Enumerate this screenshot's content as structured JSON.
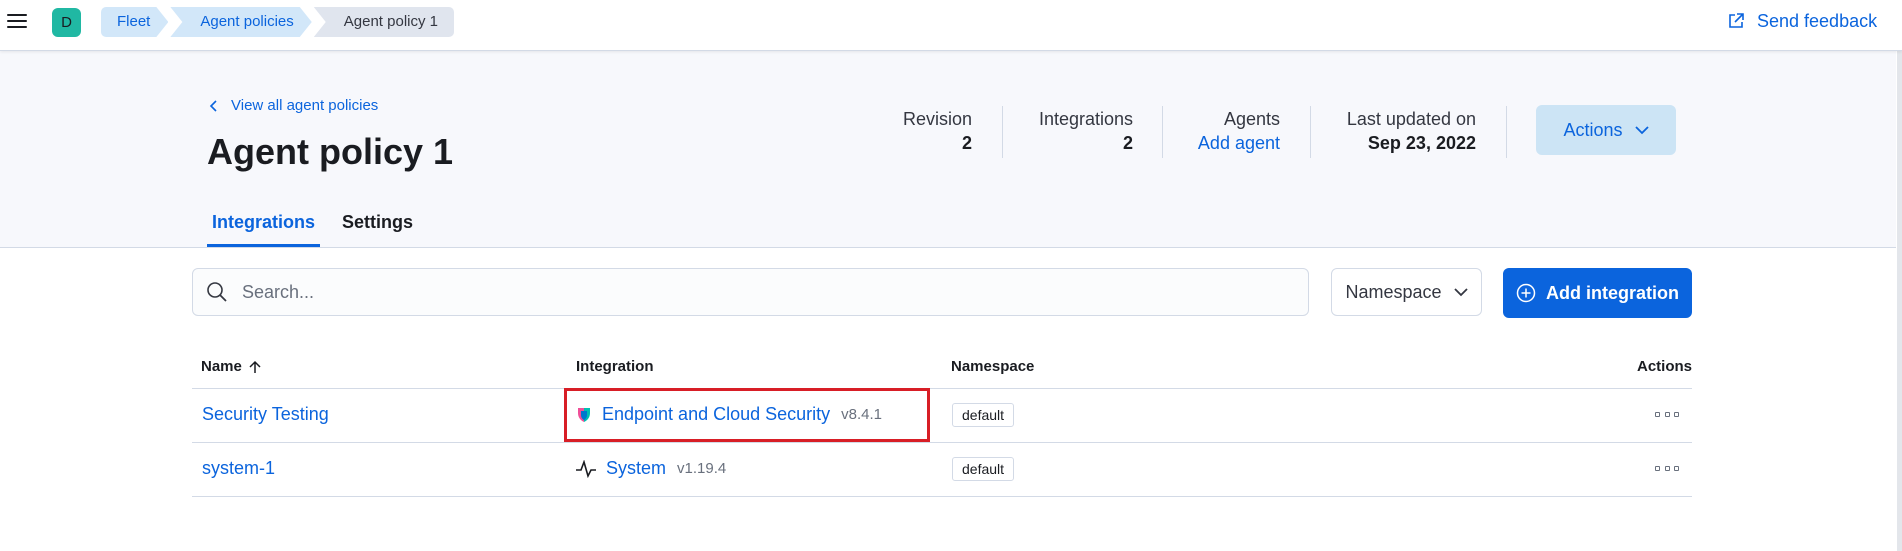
{
  "topbar": {
    "avatar_initial": "D",
    "breadcrumbs": [
      "Fleet",
      "Agent policies",
      "Agent policy 1"
    ],
    "feedback_label": "Send feedback"
  },
  "header": {
    "back_link": "View all agent policies",
    "title": "Agent policy 1",
    "stats": {
      "revision_label": "Revision",
      "revision_value": "2",
      "integrations_label": "Integrations",
      "integrations_value": "2",
      "agents_label": "Agents",
      "agents_value": "Add agent",
      "updated_label": "Last updated on",
      "updated_value": "Sep 23, 2022"
    },
    "actions_label": "Actions",
    "tabs": [
      "Integrations",
      "Settings"
    ]
  },
  "toolbar": {
    "search_placeholder": "Search...",
    "namespace_label": "Namespace",
    "add_integration_label": "Add integration"
  },
  "table": {
    "columns": [
      "Name",
      "Integration",
      "Namespace",
      "Actions"
    ],
    "rows": [
      {
        "name": "Security Testing",
        "integration": "Endpoint and Cloud Security",
        "version": "v8.4.1",
        "namespace": "default"
      },
      {
        "name": "system-1",
        "integration": "System",
        "version": "v1.19.4",
        "namespace": "default"
      }
    ]
  },
  "colors": {
    "accent": "#0b64dd",
    "highlight": "#d81e26",
    "avatar": "#20b8a3"
  },
  "icons": [
    "menu-icon",
    "external-link-icon",
    "chevron-left-icon",
    "chevron-down-icon",
    "search-icon",
    "plus-circle-icon",
    "arrow-up-icon",
    "endpoint-shield-icon",
    "system-pulse-icon",
    "more-dots-icon"
  ]
}
